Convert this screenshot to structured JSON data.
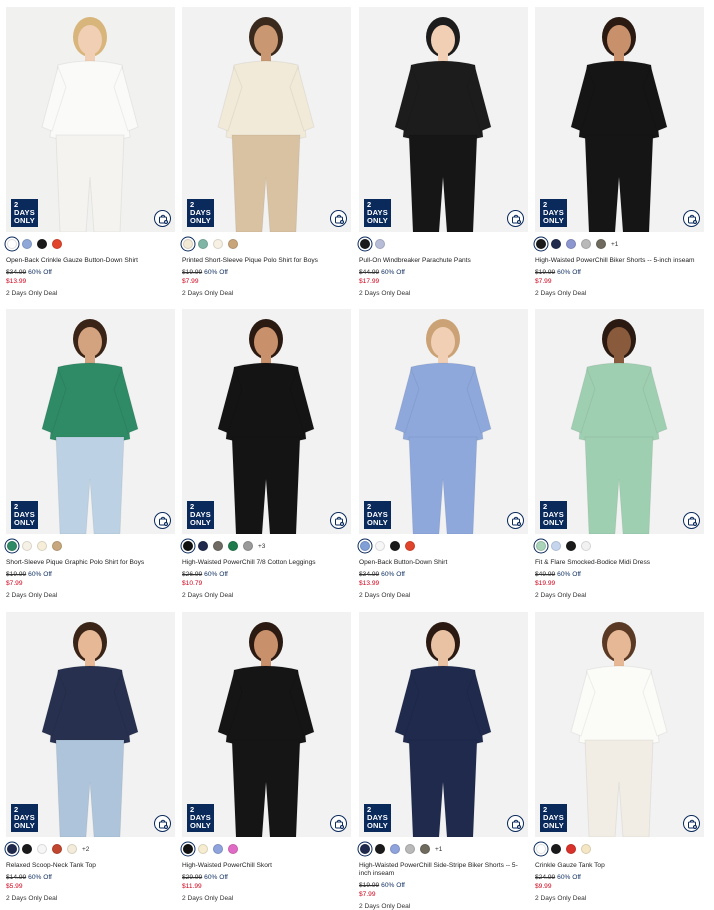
{
  "colors": {
    "badge": "#0a2a5c",
    "sale_price": "#d0021b",
    "accent": "#0a2a5c"
  },
  "products": [
    {
      "name": "Open-Back Crinkle Gauze Button-Down Shirt",
      "badge": [
        "2 DAYS",
        "ONLY"
      ],
      "was_price": "$34.99",
      "discount": "60% Off",
      "sale_price": "$13.99",
      "deal": "2 Days Only Deal",
      "swatches": [
        "#ffffff",
        "#8fa8d8",
        "#1a1a1a",
        "#e0452c"
      ],
      "more": "",
      "image": {
        "bg": "#f1f1ef",
        "top": "#fafaf8",
        "bottom": "#f4f3ef",
        "skin": "#f0cfb5",
        "hair": "#d8b57a"
      }
    },
    {
      "name": "Printed Short-Sleeve Pique Polo Shirt for Boys",
      "badge": [
        "2 DAYS",
        "ONLY"
      ],
      "was_price": "$19.99",
      "discount": "60% Off",
      "sale_price": "$7.99",
      "deal": "2 Days Only Deal",
      "swatches": [
        "#f3ead6",
        "#7fb5a5",
        "#f7f1e3",
        "#c9a57a"
      ],
      "more": "",
      "image": {
        "bg": "#f2f2f2",
        "top": "#f1ead8",
        "bottom": "#d9c2a2",
        "skin": "#c99872",
        "hair": "#3a2a1e"
      }
    },
    {
      "name": "Pull-On Windbreaker Parachute Pants",
      "badge": [
        "2 DAYS",
        "ONLY"
      ],
      "was_price": "$44.99",
      "discount": "60% Off",
      "sale_price": "$17.99",
      "deal": "2 Days Only Deal",
      "swatches": [
        "#1a1a1a",
        "#b7bdd6"
      ],
      "more": "",
      "image": {
        "bg": "#f2f2f2",
        "top": "#1c1c1c",
        "bottom": "#161616",
        "skin": "#f0cfb5",
        "hair": "#1c1c1c"
      }
    },
    {
      "name": "High-Waisted PowerChill Biker Shorts -- 5-inch inseam",
      "badge": [
        "2 DAYS",
        "ONLY"
      ],
      "was_price": "$19.99",
      "discount": "60% Off",
      "sale_price": "$7.99",
      "deal": "2 Days Only Deal",
      "swatches": [
        "#1a1a1a",
        "#1f2a4d",
        "#8c96cf",
        "#b9b9b9",
        "#6f6a5e"
      ],
      "more": "+1",
      "image": {
        "bg": "#f2f2f2",
        "top": "#151515",
        "bottom": "#151515",
        "skin": "#c8906b",
        "hair": "#2a1a12"
      }
    },
    {
      "name": "Short-Sleeve Pique Graphic Polo Shirt for Boys",
      "badge": [
        "2 DAYS",
        "ONLY"
      ],
      "was_price": "$19.99",
      "discount": "60% Off",
      "sale_price": "$7.99",
      "deal": "2 Days Only Deal",
      "swatches": [
        "#2f8a66",
        "#f6f1e6",
        "#f6eed9",
        "#c7a77e"
      ],
      "more": "",
      "image": {
        "bg": "#f2f2f2",
        "top": "#2f8a66",
        "bottom": "#bcd2e4",
        "skin": "#d3a27f",
        "hair": "#3a2417"
      }
    },
    {
      "name": "High-Waisted PowerChill 7/8 Cotton Leggings",
      "badge": [
        "2 DAYS",
        "ONLY"
      ],
      "was_price": "$26.99",
      "discount": "60% Off",
      "sale_price": "$10.79",
      "deal": "2 Days Only Deal",
      "swatches": [
        "#111111",
        "#1f2a4d",
        "#6f6a63",
        "#1f7a4c",
        "#9a9a9a"
      ],
      "more": "+3",
      "image": {
        "bg": "#f2f2f2",
        "top": "#141414",
        "bottom": "#141414",
        "skin": "#c8906b",
        "hair": "#2a1a12"
      }
    },
    {
      "name": "Open-Back Button-Down Shirt",
      "badge": [
        "2 DAYS",
        "ONLY"
      ],
      "was_price": "$34.99",
      "discount": "60% Off",
      "sale_price": "$13.99",
      "deal": "2 Days Only Deal",
      "swatches": [
        "#7f9fd6",
        "#f7f7f7",
        "#1a1a1a",
        "#e0452c"
      ],
      "more": "",
      "image": {
        "bg": "#f2f2f2",
        "top": "#8ea8dc",
        "bottom": "#8ea8dc",
        "skin": "#f0cfb5",
        "hair": "#caa275"
      }
    },
    {
      "name": "Fit & Flare Smocked-Bodice Midi Dress",
      "badge": [
        "2 DAYS",
        "ONLY"
      ],
      "was_price": "$49.99",
      "discount": "60% Off",
      "sale_price": "$19.99",
      "deal": "2 Days Only Deal",
      "swatches": [
        "#a9d4b9",
        "#c6d5ee",
        "#1a1a1a",
        "#f2f2f2"
      ],
      "more": "",
      "image": {
        "bg": "#f2f2f2",
        "top": "#9fcfb1",
        "bottom": "#9fcfb1",
        "skin": "#8a5a3d",
        "hair": "#2a1a12"
      }
    },
    {
      "name": "Relaxed Scoop-Neck Tank Top",
      "badge": [
        "2 DAYS",
        "ONLY"
      ],
      "was_price": "$14.99",
      "discount": "60% Off",
      "sale_price": "$5.99",
      "deal": "2 Days Only Deal",
      "swatches": [
        "#1f2a4d",
        "#1a1a1a",
        "#f6f6f6",
        "#c0462f",
        "#f4ecda"
      ],
      "more": "+2",
      "image": {
        "bg": "#f2f2f2",
        "top": "#27314f",
        "bottom": "#aec4da",
        "skin": "#e6b895",
        "hair": "#3a2417"
      }
    },
    {
      "name": "High-Waisted PowerChill Skort",
      "badge": [
        "2 DAYS",
        "ONLY"
      ],
      "was_price": "$29.99",
      "discount": "60% Off",
      "sale_price": "$11.99",
      "deal": "2 Days Only Deal",
      "swatches": [
        "#111111",
        "#f6ecd0",
        "#8fa3dc",
        "#e06bc4"
      ],
      "more": "",
      "image": {
        "bg": "#f2f2f2",
        "top": "#151515",
        "bottom": "#151515",
        "skin": "#c8906b",
        "hair": "#2a1a12"
      }
    },
    {
      "name": "High-Waisted PowerChill Side-Stripe Biker Shorts -- 5-inch inseam",
      "badge": [
        "2 DAYS",
        "ONLY"
      ],
      "was_price": "$19.99",
      "discount": "60% Off",
      "sale_price": "$7.99",
      "deal": "2 Days Only Deal",
      "swatches": [
        "#1f2a4d",
        "#1a1a1a",
        "#8fa3dc",
        "#b9b9b9",
        "#6f6a5e"
      ],
      "more": "+1",
      "image": {
        "bg": "#f2f2f2",
        "top": "#1f2a4d",
        "bottom": "#1f2a4d",
        "skin": "#e9c2a4",
        "hair": "#2a1a12"
      }
    },
    {
      "name": "Crinkle Gauze Tank Top",
      "badge": [
        "2 DAYS",
        "ONLY"
      ],
      "was_price": "$24.99",
      "discount": "60% Off",
      "sale_price": "$9.99",
      "deal": "2 Days Only Deal",
      "swatches": [
        "#ffffff",
        "#1a1a1a",
        "#d8322a",
        "#f6e7c4"
      ],
      "more": "",
      "image": {
        "bg": "#f2f2f2",
        "top": "#fbfbf8",
        "bottom": "#f1ede4",
        "skin": "#e6b895",
        "hair": "#5a3a24"
      }
    }
  ]
}
